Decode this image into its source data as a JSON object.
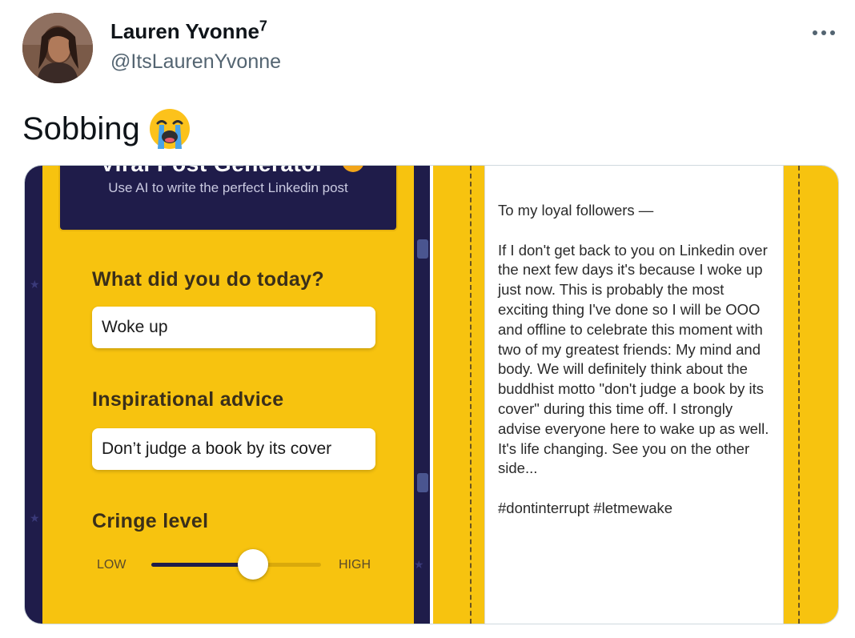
{
  "tweet": {
    "author_name": "Lauren Yvonne",
    "author_badge": "7",
    "author_handle": "@ItsLaurenYvonne",
    "text": "Sobbing",
    "emoji": "loudly-crying-face",
    "more_icon": "more-horizontal-icon"
  },
  "screenshot_left": {
    "subtitle": "Use AI to write the perfect Linkedin post",
    "fields": [
      {
        "label": "What did you do today?",
        "value": "Woke up"
      },
      {
        "label": "Inspirational advice",
        "value": "Don’t judge a book by its cover"
      }
    ],
    "slider": {
      "label": "Cringe level",
      "low_label": "LOW",
      "high_label": "HIGH",
      "value": 0.6
    }
  },
  "screenshot_right": {
    "post_text": "To my loyal followers —\n\nIf I don't get back to you on Linkedin over the next few days it's because I woke up just now. This is probably the most exciting thing I've done so I will be OOO and offline to celebrate this moment with two of my greatest friends: My mind and body. We will definitely think about the buddhist motto \"don't judge a book by its cover\" during this time off. I strongly advise everyone here to wake up as well. It's life changing. See you on the other side...\n\n#dontinterrupt #letmewake"
  },
  "colors": {
    "accent_yellow": "#f7c30f",
    "navy": "#1f1c4a",
    "text_primary": "#0f1419",
    "text_secondary": "#536471"
  }
}
